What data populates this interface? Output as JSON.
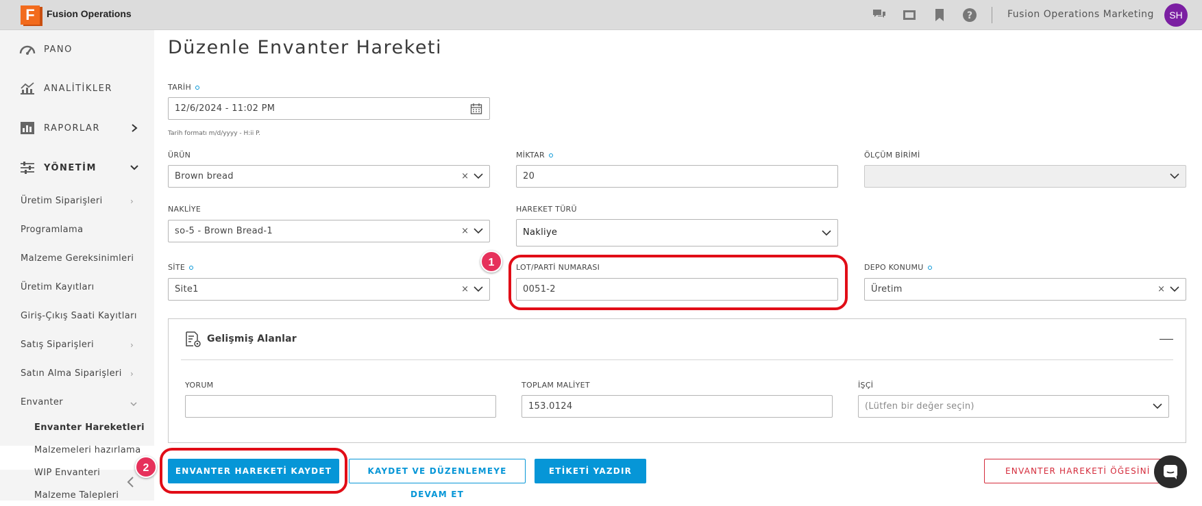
{
  "header": {
    "logo_letter": "F",
    "app_name": "Fusion Operations",
    "org_name": "Fusion Operations Marketing",
    "avatar_initials": "SH",
    "icons": [
      "chat-icon",
      "screen-icon",
      "bookmark-icon",
      "help-icon"
    ]
  },
  "sidebar": {
    "main_items": [
      {
        "label": "PANO",
        "icon": "dashboard-icon"
      },
      {
        "label": "ANALİTİKLER",
        "icon": "analytics-icon"
      },
      {
        "label": "RAPORLAR",
        "icon": "reports-icon"
      },
      {
        "label": "YÖNETİM",
        "icon": "sliders-icon"
      }
    ],
    "sub_items": [
      "Üretim Siparişleri",
      "Programlama",
      "Malzeme Gereksinimleri",
      "Üretim Kayıtları",
      "Giriş-Çıkış Saati Kayıtları",
      "Satış Siparişleri",
      "Satın Alma Siparişleri",
      "Envanter"
    ],
    "envanter_items": [
      "Envanter Hareketleri",
      "Malzemeleri hazırlama",
      "WIP Envanteri",
      "Malzeme Talepleri"
    ]
  },
  "page": {
    "title": "Düzenle Envanter Hareketi"
  },
  "form": {
    "tarih": {
      "label": "TARİH",
      "value": "12/6/2024 - 11:02 PM",
      "hint": "Tarih formatı m/d/yyyy - H:ii P."
    },
    "urun": {
      "label": "ÜRÜN",
      "value": "Brown bread"
    },
    "miktar": {
      "label": "MİKTAR",
      "value": "20"
    },
    "olcum": {
      "label": "ÖLÇÜM BİRİMİ",
      "value": ""
    },
    "nakliye": {
      "label": "NAKLİYE",
      "value": "so-5 - Brown Bread-1"
    },
    "hareket": {
      "label": "HAREKET TÜRÜ",
      "value": "Nakliye"
    },
    "site": {
      "label": "SİTE",
      "value": "Site1"
    },
    "lot": {
      "label": "LOT/PARTİ NUMARASI",
      "value": "0051-2"
    },
    "depo": {
      "label": "DEPO KONUMU",
      "value": "Üretim"
    },
    "clear_glyph": "×"
  },
  "advanced": {
    "title": "Gelişmiş Alanlar",
    "yorum": {
      "label": "YORUM",
      "value": ""
    },
    "maliyet": {
      "label": "TOPLAM MALİYET",
      "value": "153.0124"
    },
    "isci": {
      "label": "İŞÇİ",
      "placeholder": "(Lütfen bir değer seçin)"
    }
  },
  "actions": {
    "save": "ENVANTER HAREKETİ KAYDET",
    "save_continue": "KAYDET VE DÜZENLEMEYE DEVAM ET",
    "print": "ETİKETİ YAZDIR",
    "delete": "ENVANTER HAREKETİ ÖĞESİNİ SİL"
  },
  "callouts": [
    "1",
    "2"
  ],
  "colors": {
    "accent": "#0696d7",
    "callout": "#e10d17",
    "danger": "#d42a3a",
    "avatar": "#7b1fa2",
    "logo": "#f26b1d"
  }
}
